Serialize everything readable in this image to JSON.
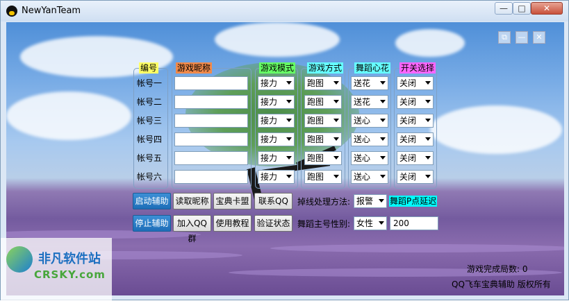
{
  "window": {
    "title": "NewYanTeam",
    "controls": {
      "minimize": "—",
      "maximize": "□",
      "close": "✕"
    }
  },
  "client_controls": {
    "restore": "⧉",
    "minimize": "—",
    "close": "✕"
  },
  "headers": {
    "id": "编号",
    "nickname": "游戏昵称",
    "mode": "游戏模式",
    "method": "游戏方式",
    "heart": "舞蹈心花",
    "switch": "开关选择"
  },
  "header_colors": {
    "id": "#ffff66",
    "nickname": "#f08a4b",
    "mode": "#66ff66",
    "method": "#66ffff",
    "heart": "#66ffff",
    "switch": "#ff66ff"
  },
  "accounts": [
    {
      "label": "帐号一",
      "nickname": "",
      "mode": "接力",
      "method": "跑图",
      "heart": "送花",
      "switch": "关闭"
    },
    {
      "label": "帐号二",
      "nickname": "",
      "mode": "接力",
      "method": "跑图",
      "heart": "送花",
      "switch": "关闭"
    },
    {
      "label": "帐号三",
      "nickname": "",
      "mode": "接力",
      "method": "跑图",
      "heart": "送心",
      "switch": "关闭"
    },
    {
      "label": "帐号四",
      "nickname": "",
      "mode": "接力",
      "method": "跑图",
      "heart": "送心",
      "switch": "关闭"
    },
    {
      "label": "帐号五",
      "nickname": "",
      "mode": "接力",
      "method": "跑图",
      "heart": "送心",
      "switch": "关闭"
    },
    {
      "label": "帐号六",
      "nickname": "",
      "mode": "接力",
      "method": "跑图",
      "heart": "送心",
      "switch": "关闭"
    }
  ],
  "buttons": {
    "start": "启动辅助",
    "read_nick": "读取昵称",
    "card": "宝典卡盟",
    "contact": "联系QQ",
    "stop": "停止辅助",
    "join_group": "加入QQ群",
    "tutorial": "使用教程",
    "verify": "验证状态"
  },
  "options": {
    "disconnect_label": "掉线处理方法:",
    "disconnect_value": "报警",
    "gender_label": "舞蹈主号性别:",
    "gender_value": "女性",
    "delay_input": "200",
    "delay_tag": "舞蹈P点延迟"
  },
  "status": {
    "games_done": "游戏完成局数: 0",
    "copyright": "QQ飞车宝典辅助 版权所有"
  },
  "watermark": {
    "main": "非凡软件站",
    "sub": "CRSKY.com"
  }
}
